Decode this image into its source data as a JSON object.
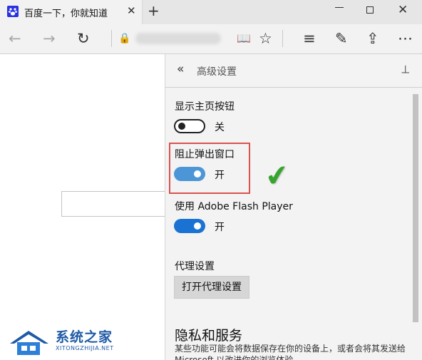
{
  "tab": {
    "title": "百度一下，你就知道",
    "favicon": "baidu-paw-icon",
    "close_glyph": "✕",
    "new_tab_glyph": "+"
  },
  "window": {
    "close_glyph": "✕"
  },
  "nav": {
    "back_glyph": "←",
    "forward_glyph": "→",
    "refresh_glyph": "↻",
    "lock_glyph": "🔒",
    "reading_view_glyph": "📖",
    "favorite_glyph": "☆",
    "hub_glyph": "≡",
    "note_glyph": "✎",
    "share_glyph": "⇪",
    "more_glyph": "⋯"
  },
  "panel": {
    "back_glyph": "«",
    "title": "高级设置",
    "pin_glyph": "⊣",
    "settings": [
      {
        "label": "显示主页按钮",
        "state": "关",
        "on": false
      },
      {
        "label": "阻止弹出窗口",
        "state": "开",
        "on": true,
        "highlighted": true
      },
      {
        "label": "使用 Adobe Flash Player",
        "state": "开",
        "on": true
      }
    ],
    "proxy": {
      "label": "代理设置",
      "button": "打开代理设置"
    },
    "privacy": {
      "heading": "隐私和服务",
      "description": "某些功能可能会将数据保存在你的设备上，或者会将其发送给 Microsoft 以改进你的浏览体验。"
    },
    "checkmark_glyph": "✔"
  },
  "watermark": {
    "name": "系统之家",
    "url": "XITONGZHIJIA.NET"
  },
  "colors": {
    "toggle_on": "#1a73d3",
    "highlight_border": "#d9534f",
    "checkmark": "#36a52e"
  }
}
